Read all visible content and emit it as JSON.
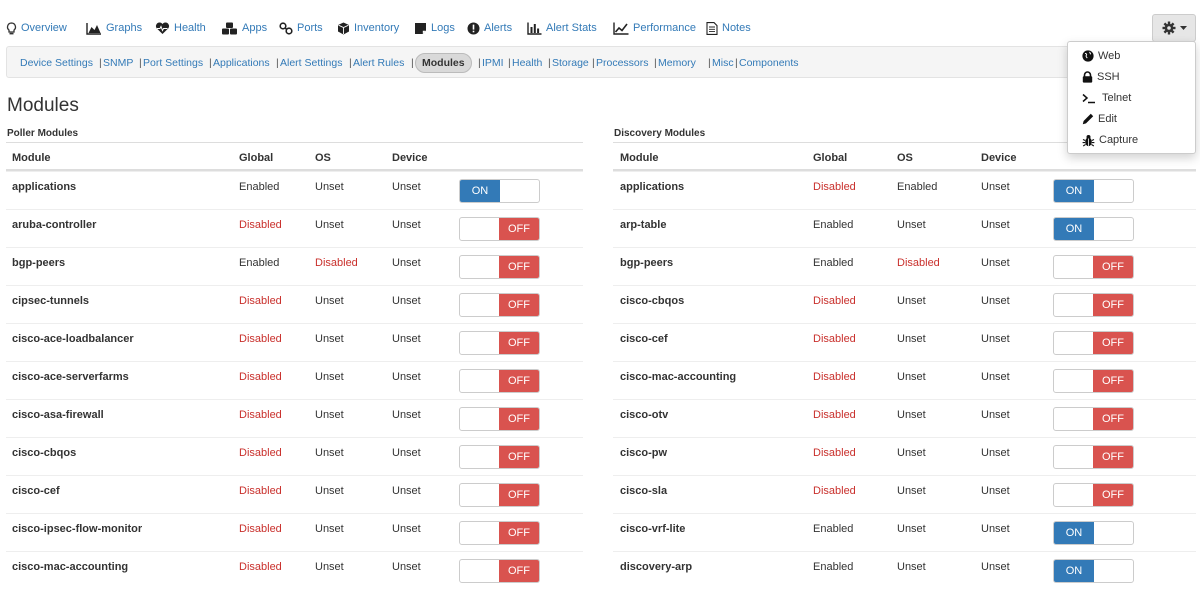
{
  "nav": {
    "items": [
      {
        "label": "Overview",
        "icon": "lightbulb-icon"
      },
      {
        "label": "Graphs",
        "icon": "area-chart-icon"
      },
      {
        "label": "Health",
        "icon": "heartbeat-icon"
      },
      {
        "label": "Apps",
        "icon": "cubes-icon"
      },
      {
        "label": "Ports",
        "icon": "link-icon"
      },
      {
        "label": "Inventory",
        "icon": "cube-icon"
      },
      {
        "label": "Logs",
        "icon": "sticky-note-icon"
      },
      {
        "label": "Alerts",
        "icon": "exclamation-circle-icon"
      },
      {
        "label": "Alert Stats",
        "icon": "bar-chart-icon"
      },
      {
        "label": "Performance",
        "icon": "line-chart-icon"
      },
      {
        "label": "Notes",
        "icon": "file-text-icon"
      }
    ],
    "gear_icon": "gear-icon",
    "caret_icon": "caret-down-icon"
  },
  "subnav": {
    "items": [
      "Device Settings",
      "SNMP",
      "Port Settings",
      "Applications",
      "Alert Settings",
      "Alert Rules",
      "Modules",
      "IPMI",
      "Health",
      "Storage",
      "Processors",
      "Memory",
      "Misc",
      "Components"
    ],
    "active": "Modules",
    "separator": "|"
  },
  "dropdown": {
    "items": [
      {
        "label": "Web",
        "icon": "globe-icon"
      },
      {
        "label": "SSH",
        "icon": "lock-icon"
      },
      {
        "label": "Telnet",
        "icon": "terminal-icon"
      },
      {
        "label": "Edit",
        "icon": "pencil-icon"
      },
      {
        "label": "Capture",
        "icon": "bug-icon"
      }
    ]
  },
  "page": {
    "title": "Modules"
  },
  "toggle": {
    "on": "ON",
    "off": "OFF"
  },
  "colors": {
    "link": "#337ab7",
    "disabled": "#c9302c",
    "toggle_on": "#337ab7",
    "toggle_off": "#d9534f"
  },
  "poller": {
    "label": "Poller Modules",
    "headers": [
      "Module",
      "Global",
      "OS",
      "Device"
    ],
    "rows": [
      {
        "module": "applications",
        "global": "Enabled",
        "os": "Unset",
        "device": "Unset",
        "state": "on"
      },
      {
        "module": "aruba-controller",
        "global": "Disabled",
        "os": "Unset",
        "device": "Unset",
        "state": "off"
      },
      {
        "module": "bgp-peers",
        "global": "Enabled",
        "os": "Disabled",
        "device": "Unset",
        "state": "off"
      },
      {
        "module": "cipsec-tunnels",
        "global": "Disabled",
        "os": "Unset",
        "device": "Unset",
        "state": "off"
      },
      {
        "module": "cisco-ace-loadbalancer",
        "global": "Disabled",
        "os": "Unset",
        "device": "Unset",
        "state": "off"
      },
      {
        "module": "cisco-ace-serverfarms",
        "global": "Disabled",
        "os": "Unset",
        "device": "Unset",
        "state": "off"
      },
      {
        "module": "cisco-asa-firewall",
        "global": "Disabled",
        "os": "Unset",
        "device": "Unset",
        "state": "off"
      },
      {
        "module": "cisco-cbqos",
        "global": "Disabled",
        "os": "Unset",
        "device": "Unset",
        "state": "off"
      },
      {
        "module": "cisco-cef",
        "global": "Disabled",
        "os": "Unset",
        "device": "Unset",
        "state": "off"
      },
      {
        "module": "cisco-ipsec-flow-monitor",
        "global": "Disabled",
        "os": "Unset",
        "device": "Unset",
        "state": "off"
      },
      {
        "module": "cisco-mac-accounting",
        "global": "Disabled",
        "os": "Unset",
        "device": "Unset",
        "state": "off"
      }
    ]
  },
  "discovery": {
    "label": "Discovery Modules",
    "headers": [
      "Module",
      "Global",
      "OS",
      "Device"
    ],
    "rows": [
      {
        "module": "applications",
        "global": "Disabled",
        "os": "Enabled",
        "device": "Unset",
        "state": "on"
      },
      {
        "module": "arp-table",
        "global": "Enabled",
        "os": "Unset",
        "device": "Unset",
        "state": "on"
      },
      {
        "module": "bgp-peers",
        "global": "Enabled",
        "os": "Disabled",
        "device": "Unset",
        "state": "off"
      },
      {
        "module": "cisco-cbqos",
        "global": "Disabled",
        "os": "Unset",
        "device": "Unset",
        "state": "off"
      },
      {
        "module": "cisco-cef",
        "global": "Disabled",
        "os": "Unset",
        "device": "Unset",
        "state": "off"
      },
      {
        "module": "cisco-mac-accounting",
        "global": "Disabled",
        "os": "Unset",
        "device": "Unset",
        "state": "off"
      },
      {
        "module": "cisco-otv",
        "global": "Disabled",
        "os": "Unset",
        "device": "Unset",
        "state": "off"
      },
      {
        "module": "cisco-pw",
        "global": "Disabled",
        "os": "Unset",
        "device": "Unset",
        "state": "off"
      },
      {
        "module": "cisco-sla",
        "global": "Disabled",
        "os": "Unset",
        "device": "Unset",
        "state": "off"
      },
      {
        "module": "cisco-vrf-lite",
        "global": "Enabled",
        "os": "Unset",
        "device": "Unset",
        "state": "on"
      },
      {
        "module": "discovery-arp",
        "global": "Enabled",
        "os": "Unset",
        "device": "Unset",
        "state": "on"
      }
    ]
  }
}
